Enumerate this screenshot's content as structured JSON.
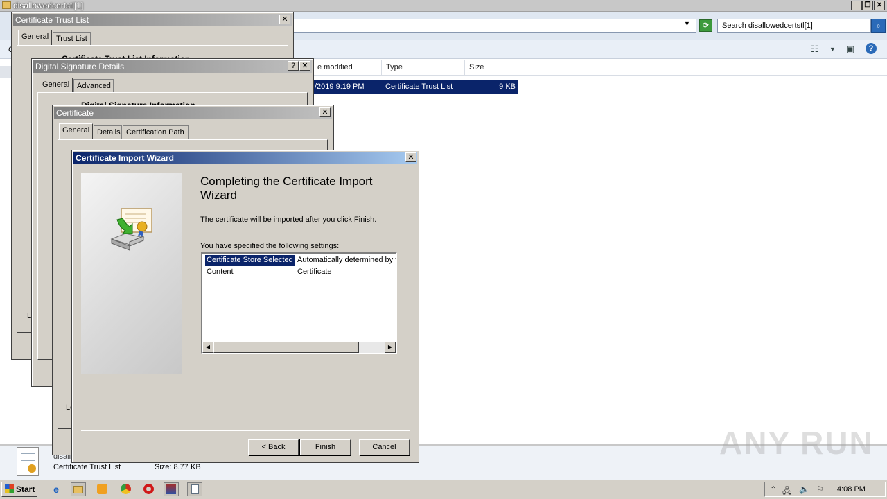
{
  "explorer": {
    "title": "disallowedcertstl[1]",
    "search_placeholder": "Search disallowedcertstl[1]",
    "columns": [
      "e modified",
      "Type",
      "Size"
    ],
    "row": {
      "date": "/2019 9:19 PM",
      "type": "Certificate Trust List",
      "size": "9 KB"
    },
    "details": {
      "filename": "disall",
      "type": "Certificate Trust List",
      "size": "Size: 8.77 KB"
    },
    "partial_c": "C",
    "partial_l1": "L",
    "partial_l2": "Le"
  },
  "ctl_dialog": {
    "title": "Certificate Trust List",
    "tabs": [
      "General",
      "Trust List"
    ],
    "heading": "Certificate Trust List Information"
  },
  "sig_dialog": {
    "title": "Digital Signature Details",
    "tabs": [
      "General",
      "Advanced"
    ],
    "heading": "Digital Signature Information",
    "help": "?"
  },
  "cert_dialog": {
    "title": "Certificate",
    "tabs": [
      "General",
      "Details",
      "Certification Path"
    ]
  },
  "wizard": {
    "title": "Certificate Import Wizard",
    "heading": "Completing the Certificate Import Wizard",
    "intro": "The certificate will be imported after you click Finish.",
    "settings_label": "You have specified the following settings:",
    "settings": [
      {
        "key": "Certificate Store Selected",
        "value": "Automatically determined by t"
      },
      {
        "key": "Content",
        "value": "Certificate"
      }
    ],
    "buttons": {
      "back": "< Back",
      "finish": "Finish",
      "cancel": "Cancel"
    }
  },
  "taskbar": {
    "start": "Start",
    "clock": "4:08 PM"
  },
  "watermark": "ANY RUN",
  "close_glyph": "✕"
}
